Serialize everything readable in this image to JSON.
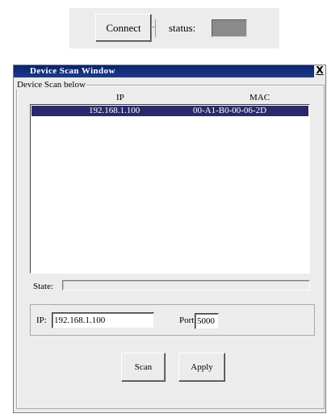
{
  "toolbar": {
    "connect_label": "Connect",
    "status_label": "status:",
    "status_color": "#8a8a8a"
  },
  "dialog": {
    "title": "Device Scan Window",
    "close_label": "X",
    "group_label": "Device Scan below",
    "list": {
      "columns": [
        "IP",
        "MAC"
      ],
      "rows": [
        {
          "ip": "192.168.1.100",
          "mac": "00-A1-B0-00-06-2D",
          "selected": true
        }
      ]
    },
    "state": {
      "label": "State:",
      "progress": 0
    },
    "ip_field": {
      "label": "IP:",
      "value": "192.168.1.100"
    },
    "port_field": {
      "label": "Port:",
      "value": "5000"
    },
    "buttons": {
      "scan_label": "Scan",
      "apply_label": "Apply"
    }
  },
  "colors": {
    "title_bar": "#0a246a",
    "selection": "#2a2a6a",
    "face": "#ececec"
  }
}
